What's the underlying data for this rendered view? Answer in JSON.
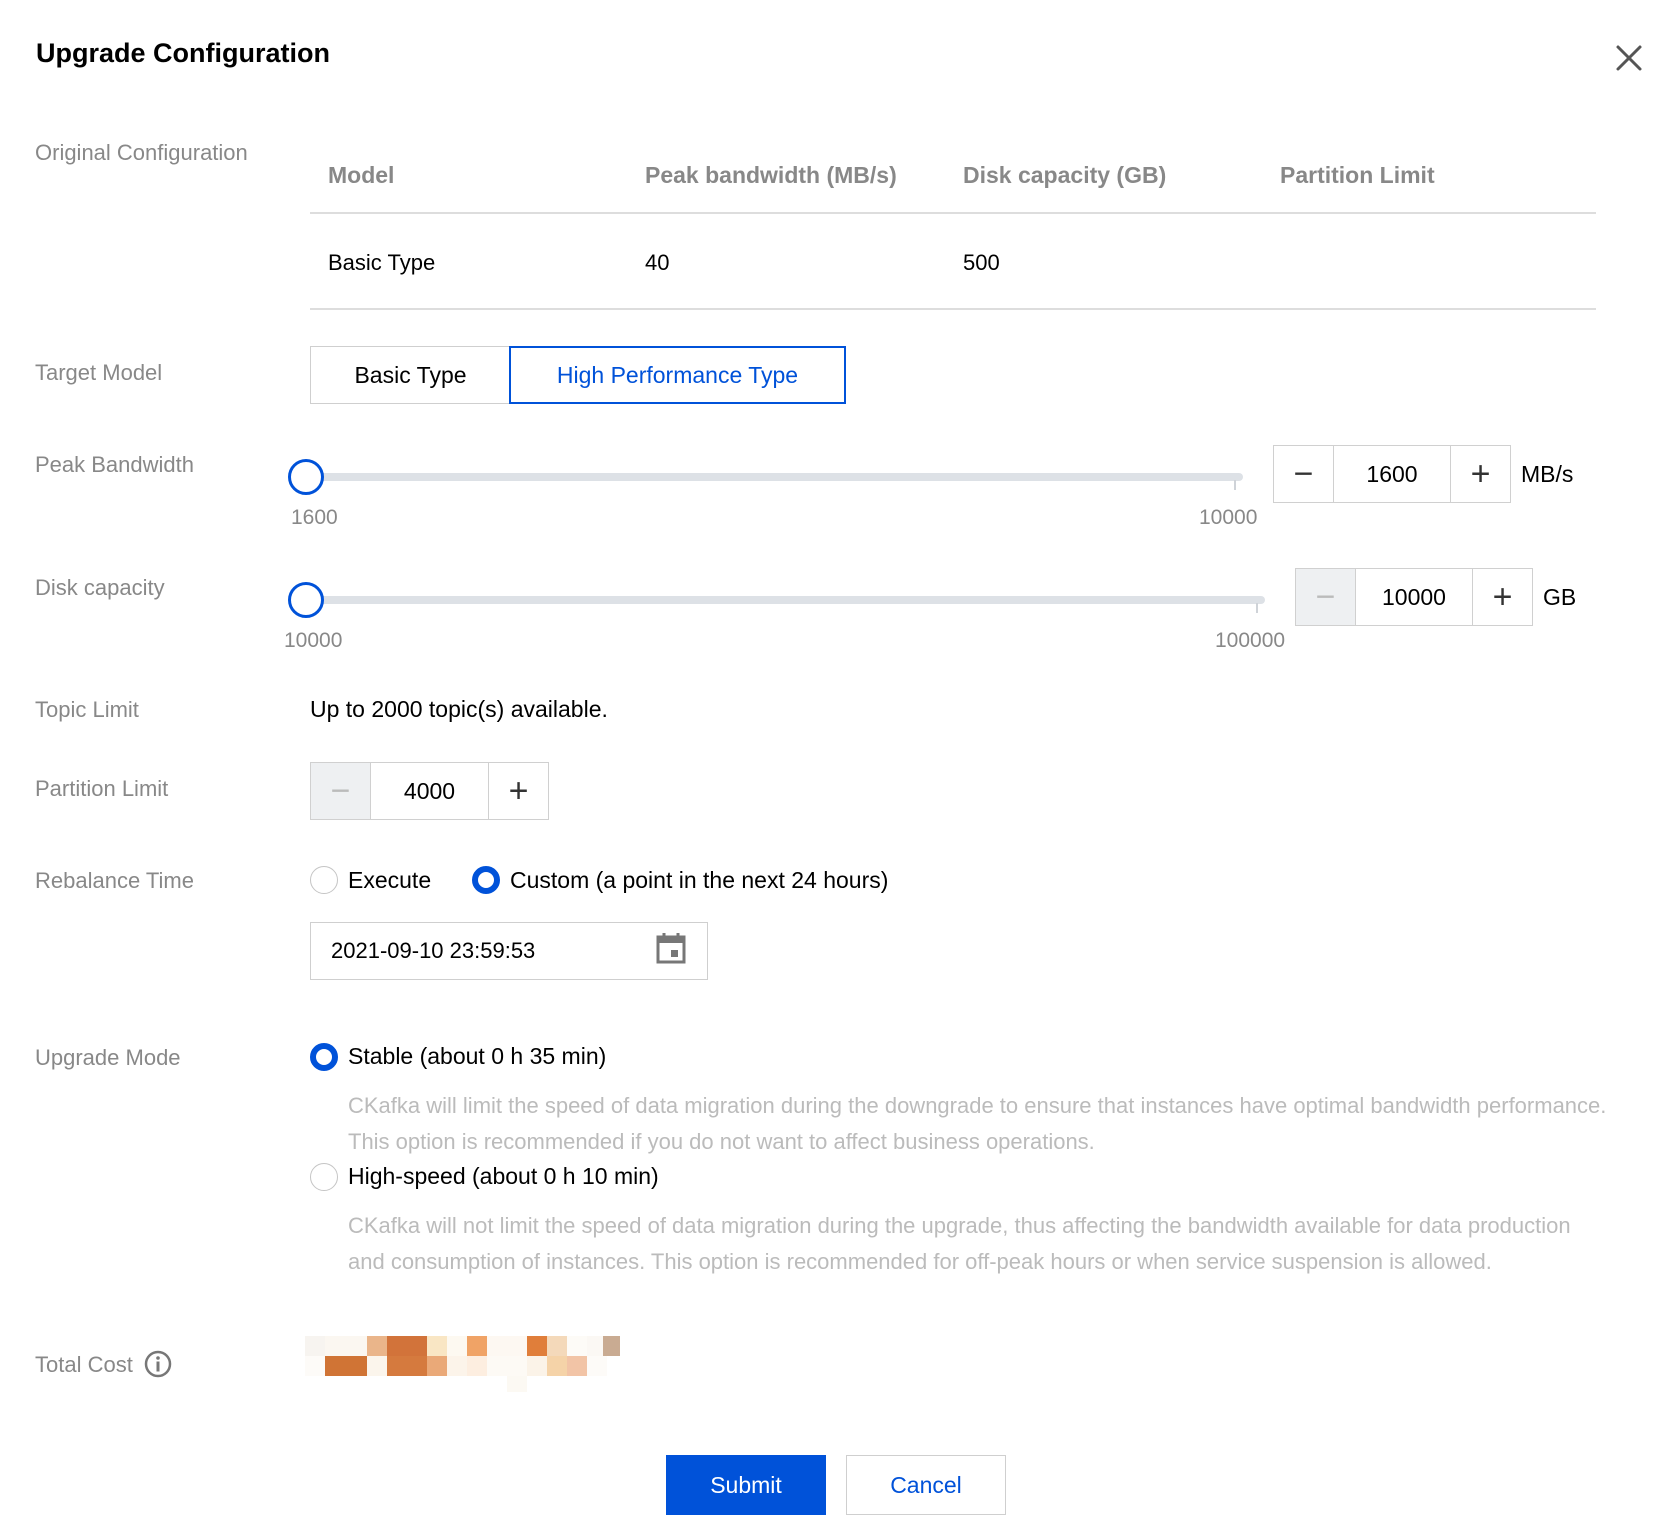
{
  "dialog": {
    "title": "Upgrade Configuration"
  },
  "labels": {
    "original": "Original Configuration",
    "target_model": "Target Model",
    "peak_bandwidth": "Peak Bandwidth",
    "disk_capacity": "Disk capacity",
    "topic_limit": "Topic Limit",
    "partition_limit": "Partition Limit",
    "rebalance_time": "Rebalance Time",
    "upgrade_mode": "Upgrade Mode",
    "total_cost": "Total Cost"
  },
  "original_table": {
    "headers": [
      "Model",
      "Peak bandwidth (MB/s)",
      "Disk capacity (GB)",
      "Partition Limit"
    ],
    "row": [
      "Basic Type",
      "40",
      "500",
      ""
    ]
  },
  "target_model": {
    "options": [
      "Basic Type",
      "High Performance Type"
    ],
    "selected": "High Performance Type"
  },
  "peak_bandwidth": {
    "min": "1600",
    "max": "10000",
    "value": "1600",
    "unit": "MB/s",
    "fraction": 0
  },
  "disk_capacity": {
    "min": "10000",
    "max": "100000",
    "value": "10000",
    "unit": "GB",
    "fraction": 0
  },
  "topic_limit": {
    "text": "Up to 2000 topic(s) available."
  },
  "partition_limit": {
    "value": "4000"
  },
  "rebalance": {
    "options": [
      "Execute",
      "Custom (a point in the next 24 hours)"
    ],
    "selected": "Custom (a point in the next 24 hours)",
    "datetime": "2021-09-10 23:59:53"
  },
  "upgrade_mode": {
    "stable_label": "Stable (about 0 h 35 min)",
    "stable_desc": "CKafka will limit the speed of data migration during the downgrade to ensure that instances have optimal bandwidth performance. This option is recommended if you do not want to affect business operations.",
    "highspeed_label": "High-speed (about 0 h 10 min)",
    "highspeed_desc": "CKafka will not limit the speed of data migration during the upgrade, thus affecting the bandwidth available for data production and consumption of instances. This option is recommended for off-peak hours or when service suspension is allowed.",
    "selected": "stable"
  },
  "actions": {
    "submit": "Submit",
    "cancel": "Cancel"
  },
  "colors": {
    "primary": "#0052d9",
    "label_gray": "#888888",
    "desc_gray": "#bbbbbb"
  }
}
